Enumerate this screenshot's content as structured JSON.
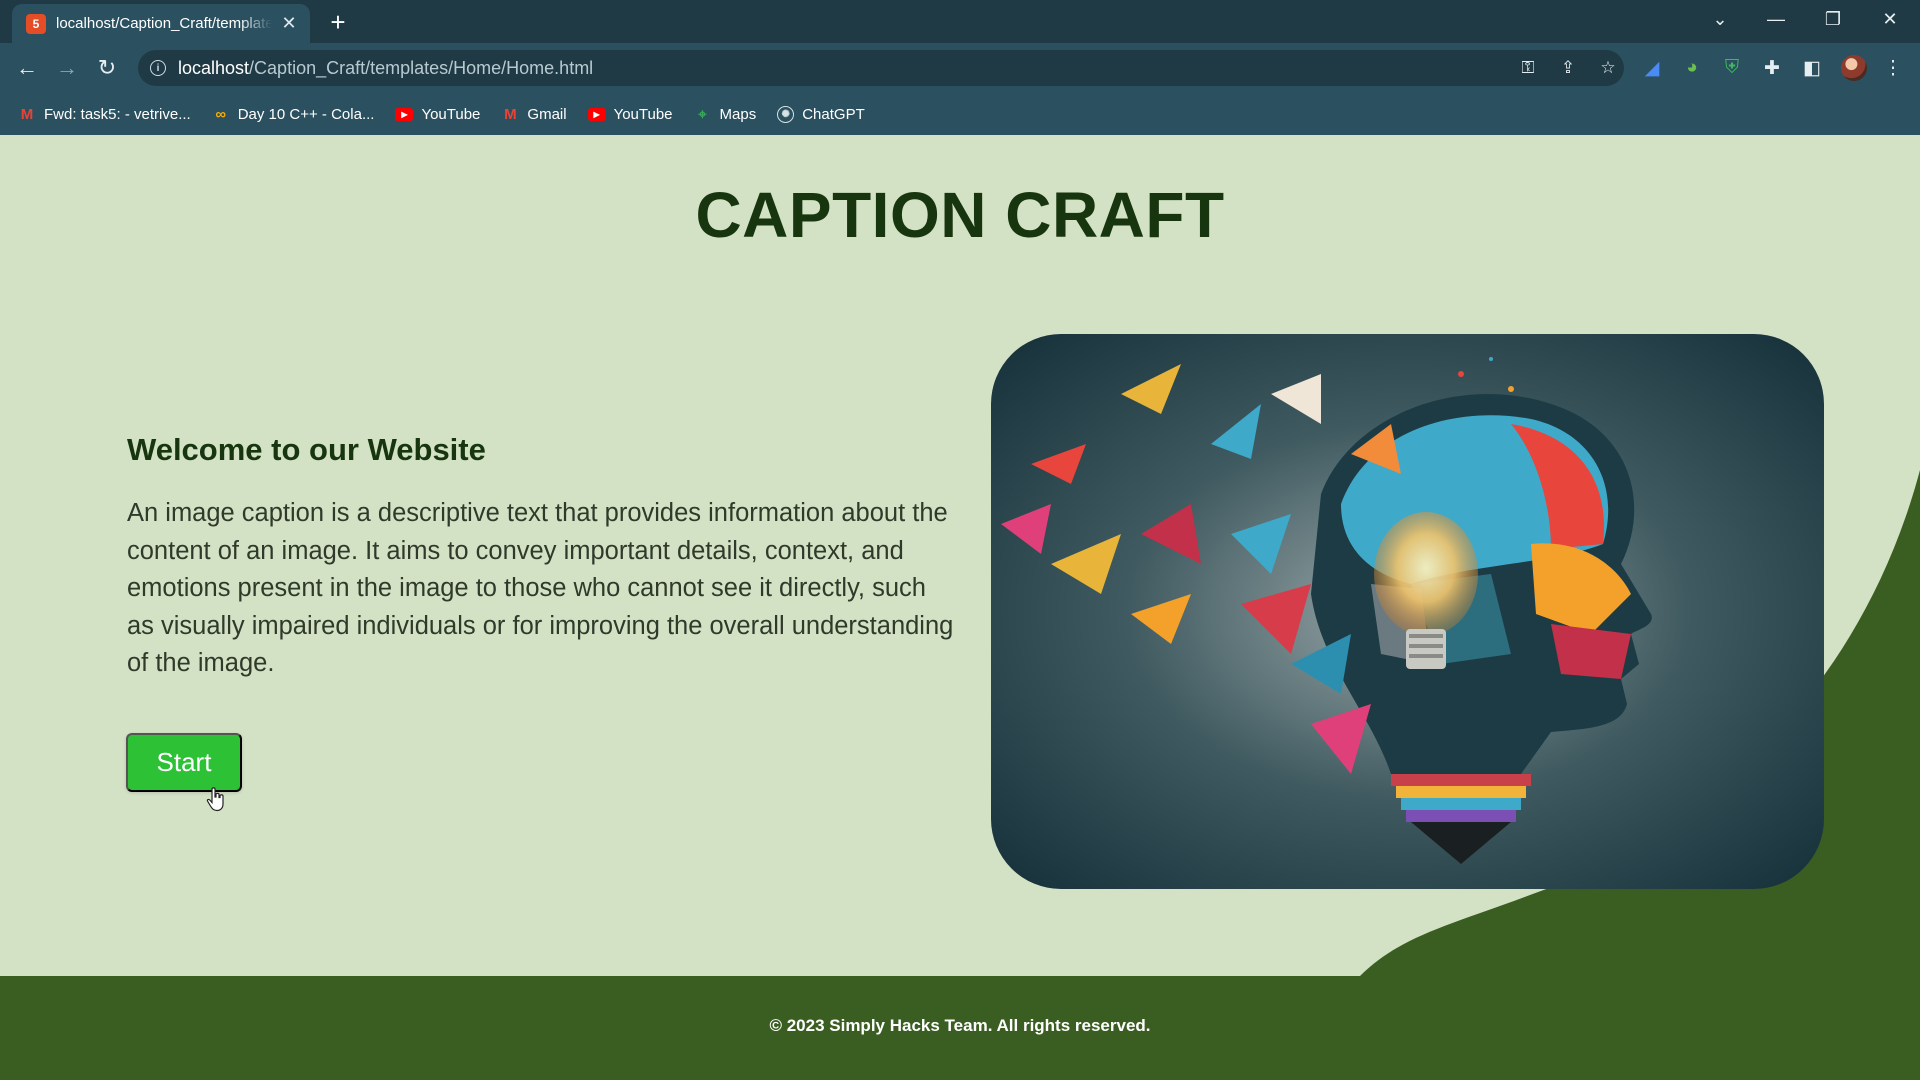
{
  "browser": {
    "tab": {
      "title": "localhost/Caption_Craft/templates/Home/Home.html",
      "favicon_label": "5"
    },
    "url_host": "localhost",
    "url_path": "/Caption_Craft/templates/Home/Home.html",
    "bookmarks": [
      {
        "label": "Fwd: task5: - vetrive...",
        "icon": "gmail-icon"
      },
      {
        "label": "Day 10 C++ - Cola...",
        "icon": "colab-icon"
      },
      {
        "label": "YouTube",
        "icon": "youtube-icon"
      },
      {
        "label": "Gmail",
        "icon": "gmail-icon"
      },
      {
        "label": "YouTube",
        "icon": "youtube-icon"
      },
      {
        "label": "Maps",
        "icon": "maps-icon"
      },
      {
        "label": "ChatGPT",
        "icon": "chatgpt-icon"
      }
    ]
  },
  "page": {
    "title": "CAPTION CRAFT",
    "welcome_heading": "Welcome to our Website",
    "description": "An image caption is a descriptive text that provides information about the content of an image. It aims to convey important details, context, and emotions present in the image to those who cannot see it directly, such as visually impaired individuals or for improving the overall understanding of the image.",
    "start_label": "Start",
    "footer": "© 2023 Simply Hacks Team. All rights reserved."
  },
  "colors": {
    "page_background": "#d3e2c5",
    "heading": "#17360f",
    "start_button": "#2dc136",
    "footer_background": "#3a5e21",
    "browser_frame": "#2b5060"
  }
}
